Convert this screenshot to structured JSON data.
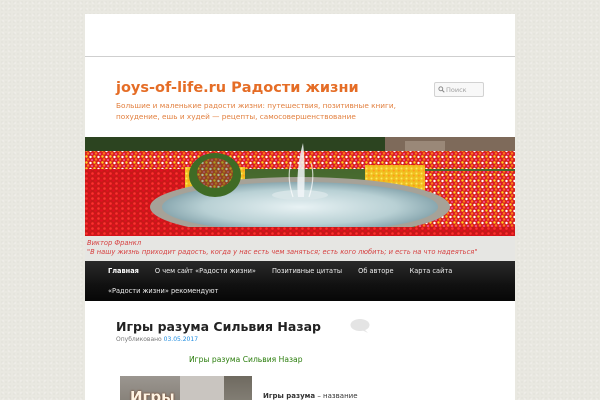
{
  "site": {
    "title": "joys-of-life.ru Радости жизни",
    "description": "Большие и маленькие радости жизни: путешествия, позитивные книги, похудение, ешь и худей — рецепты, самосовершенствование"
  },
  "search": {
    "placeholder": "Поиск",
    "icon": "search-icon"
  },
  "quote": {
    "author": "Виктор Франкл",
    "text": "\"В нашу жизнь приходит радость, когда у нас есть чем заняться; есть кого любить; и есть на что надеяться\""
  },
  "menu": {
    "items": [
      "Главная",
      "О чем сайт «Радости жизни»",
      "Позитивные цитаты",
      "Об авторе",
      "Карта сайта",
      "«Радости жизни» рекомендуют"
    ],
    "active_index": 0
  },
  "post": {
    "title": "Игры разума Сильвия Назар",
    "meta_prefix": "Опубликовано",
    "date": "03.05.2017",
    "inner_title": "Игры разума Сильвия Назар",
    "thumb_text": "Игры",
    "excerpt_bold": "Игры разума",
    "excerpt_rest": " – название книги Сильвии Назар о"
  },
  "colors": {
    "site_title": "#e56d26",
    "quote": "#d64040",
    "menu_bg": "#111111",
    "date_link": "#1b8be0",
    "inner_title": "#2a7d0b"
  }
}
